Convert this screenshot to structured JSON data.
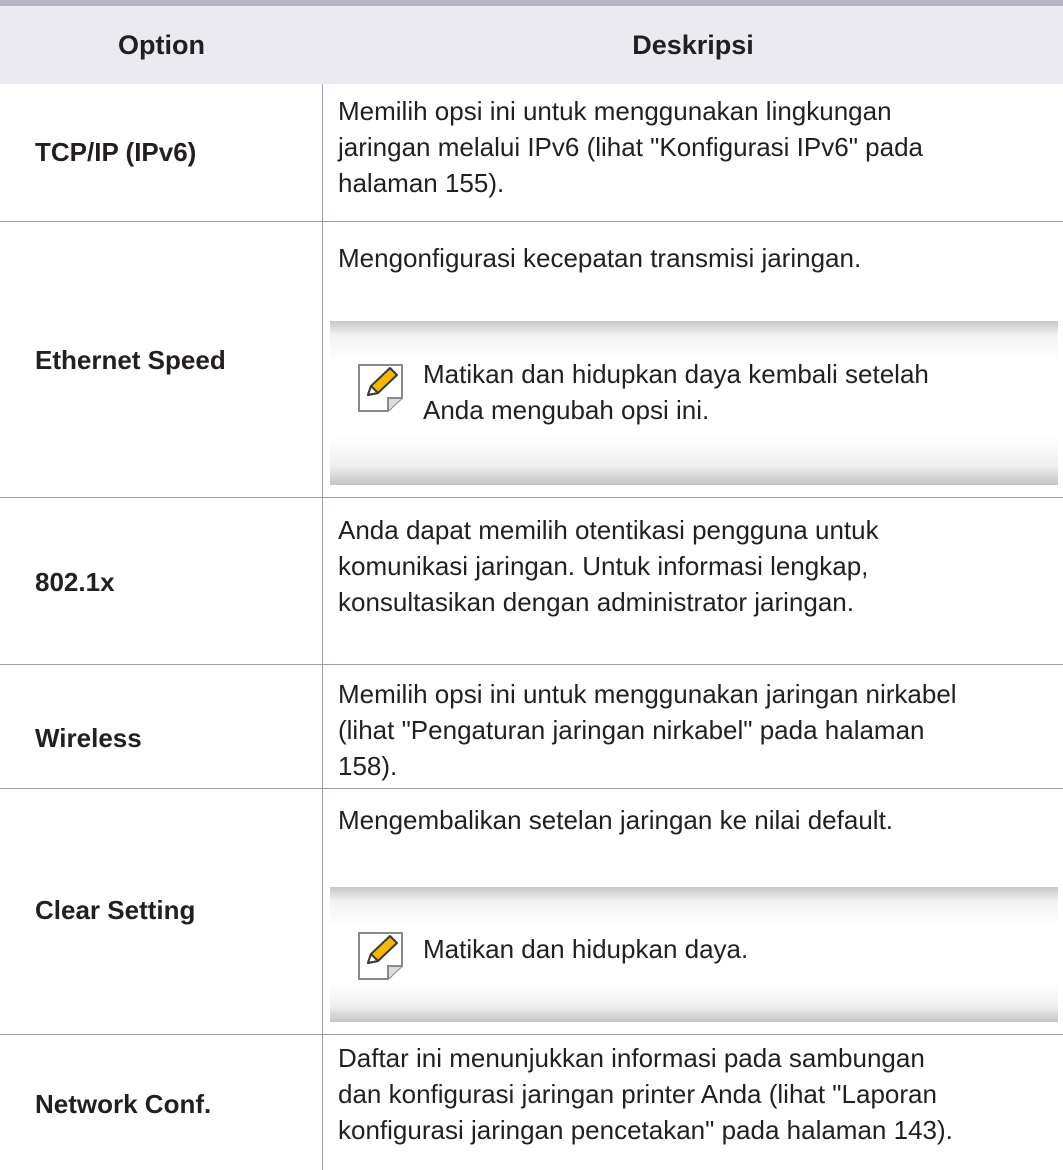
{
  "header": {
    "option": "Option",
    "description": "Deskripsi"
  },
  "rows": [
    {
      "option": "TCP/IP (IPv6)",
      "lines": [
        "Memilih opsi ini untuk menggunakan lingkungan",
        "jaringan melalui IPv6 (lihat \"Konfigurasi IPv6\" pada",
        "halaman 155)."
      ]
    },
    {
      "option": "Ethernet Speed",
      "lines": [
        "Mengonfigurasi kecepatan transmisi jaringan."
      ],
      "note": [
        "Matikan dan hidupkan daya kembali setelah",
        "Anda mengubah opsi ini."
      ]
    },
    {
      "option": "802.1x",
      "lines": [
        "Anda dapat memilih otentikasi pengguna untuk",
        "komunikasi jaringan. Untuk informasi lengkap,",
        "konsultasikan dengan administrator jaringan."
      ]
    },
    {
      "option": "Wireless",
      "lines": [
        "Memilih opsi ini untuk menggunakan jaringan nirkabel",
        "(lihat \"Pengaturan jaringan nirkabel\" pada halaman",
        "158)."
      ]
    },
    {
      "option": "Clear Setting",
      "lines": [
        "Mengembalikan setelan jaringan ke nilai default."
      ],
      "note": [
        "Matikan dan hidupkan daya."
      ]
    },
    {
      "option": "Network Conf.",
      "lines": [
        "Daftar ini menunjukkan informasi pada sambungan",
        "dan konfigurasi jaringan printer Anda (lihat \"Laporan",
        "konfigurasi jaringan pencetakan\" pada halaman 143)."
      ]
    }
  ],
  "icons": {
    "note": "note-pencil-icon"
  },
  "colors": {
    "header_bg": "#ebeaf0",
    "border": "#9f9cae",
    "icon_accent": "#f5b800"
  }
}
